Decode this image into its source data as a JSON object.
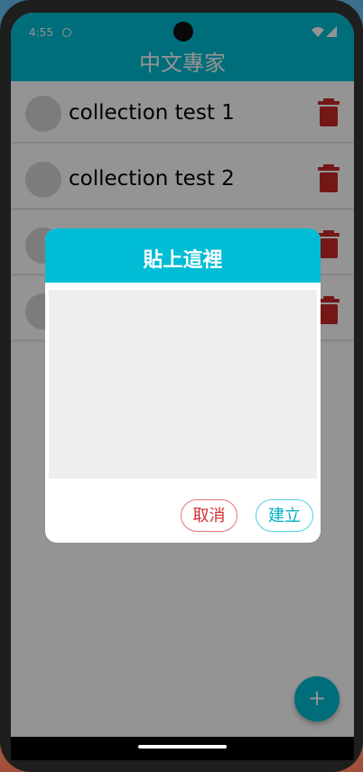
{
  "status_bar": {
    "time": "4:55"
  },
  "app_bar": {
    "title": "中文專家"
  },
  "collections": [
    {
      "label": "collection test 1"
    },
    {
      "label": "collection test 2"
    },
    {
      "label": ""
    },
    {
      "label": ""
    }
  ],
  "dialog": {
    "title": "貼上這裡",
    "paste_value": "",
    "cancel_label": "取消",
    "create_label": "建立"
  },
  "fab": {
    "label": "+"
  },
  "colors": {
    "primary": "#00bcd4",
    "delete": "#b71c1c",
    "cancel": "#d32f2f",
    "create": "#00acc1"
  },
  "icons": {
    "delete": "trash-icon",
    "add": "plus-icon",
    "wifi": "wifi-icon",
    "signal": "signal-icon"
  }
}
